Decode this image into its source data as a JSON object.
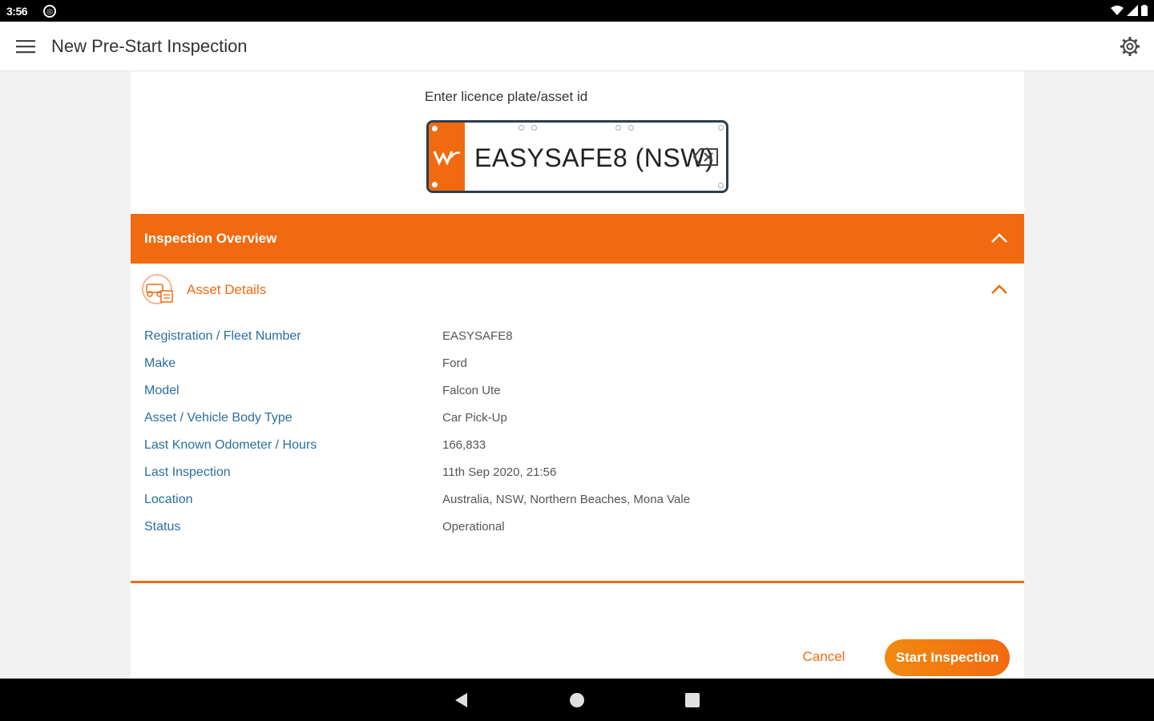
{
  "status_bar": {
    "time": "3:56",
    "notification_icon": "notification-badge-icon",
    "icons": [
      "wifi-icon",
      "signal-icon",
      "battery-icon"
    ]
  },
  "app_bar": {
    "title": "New Pre-Start Inspection",
    "menu_icon": "menu-icon",
    "settings_icon": "gear-icon"
  },
  "plate": {
    "label": "Enter licence plate/asset id",
    "value": "EASYSAFE8 (NSW)",
    "clear_icon": "backspace-icon"
  },
  "overview": {
    "title": "Inspection Overview"
  },
  "asset": {
    "title": "Asset Details",
    "rows": [
      {
        "label": "Registration / Fleet Number",
        "value": "EASYSAFE8"
      },
      {
        "label": "Make",
        "value": "Ford"
      },
      {
        "label": "Model",
        "value": "Falcon Ute"
      },
      {
        "label": "Asset / Vehicle Body Type",
        "value": "Car Pick-Up"
      },
      {
        "label": "Last Known Odometer / Hours",
        "value": "166,833"
      },
      {
        "label": "Last Inspection",
        "value": "11th Sep 2020, 21:56"
      },
      {
        "label": "Location",
        "value": "Australia, NSW, Northern Beaches, Mona Vale"
      },
      {
        "label": "Status",
        "value": "Operational"
      }
    ]
  },
  "actions": {
    "cancel": "Cancel",
    "start": "Start Inspection"
  },
  "colors": {
    "accent": "#f26a10",
    "label_blue": "#2b6ea0",
    "plate_border": "#2c3e50"
  }
}
